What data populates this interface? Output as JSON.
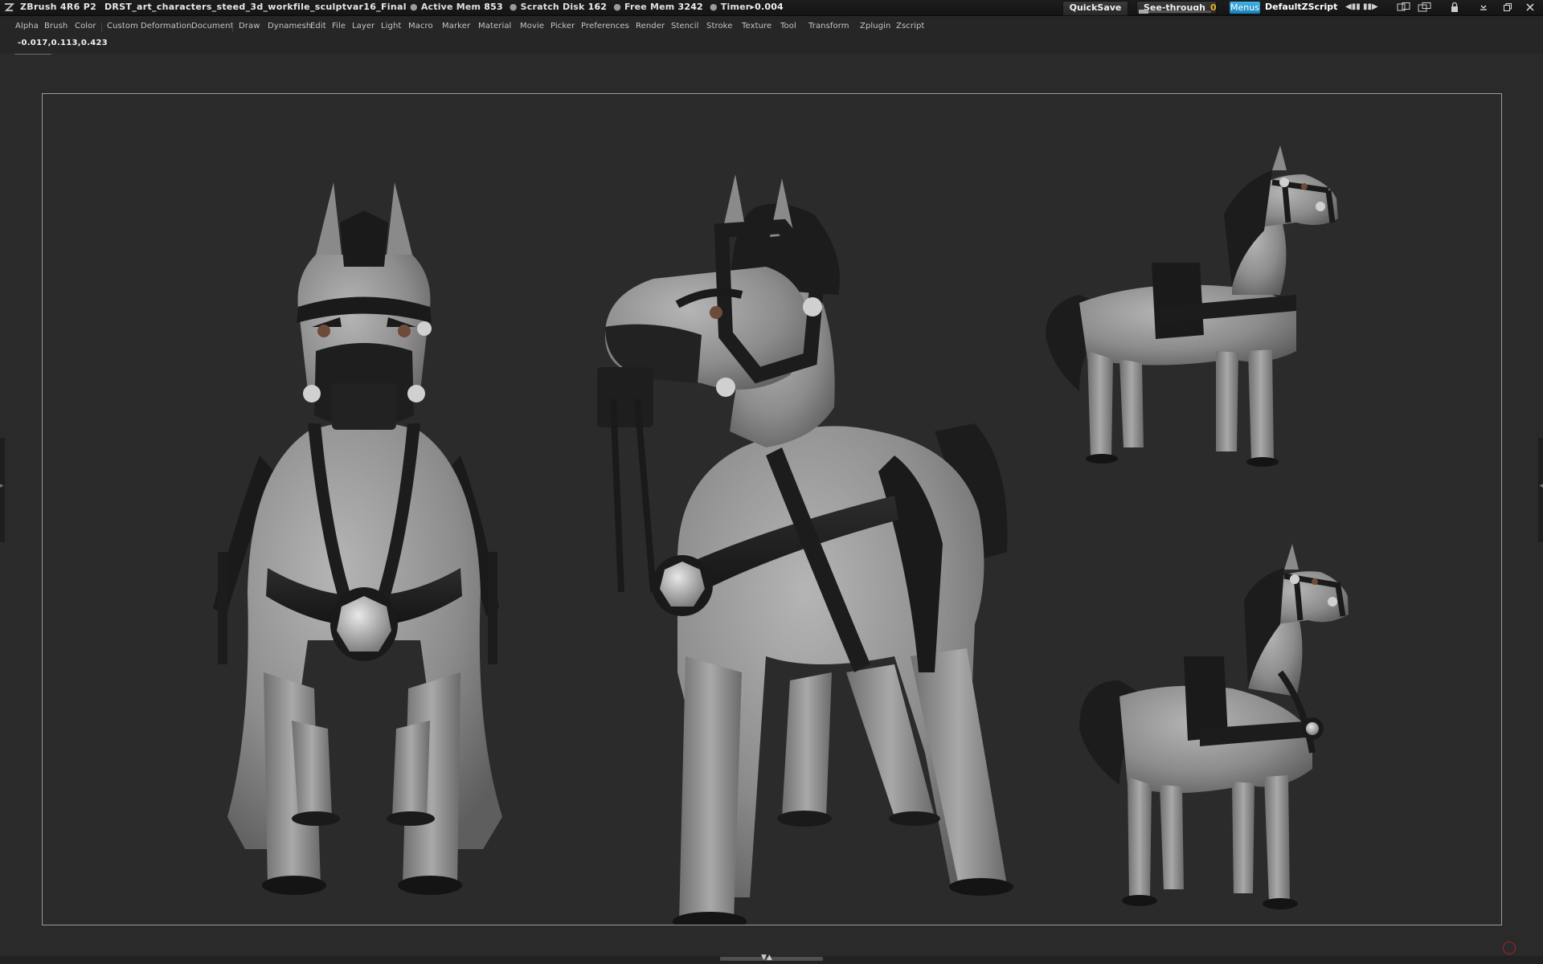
{
  "titlebar": {
    "app_name": "ZBrush 4R6 P2",
    "file_name": "DRST_art_characters_steed_3d_workfile_sculptvar16_Final",
    "stats": [
      {
        "label": "Active Mem",
        "value": "853"
      },
      {
        "label": "Scratch Disk",
        "value": "162"
      },
      {
        "label": "Free Mem",
        "value": "3242"
      },
      {
        "label": "Timer▸",
        "value": "0.004"
      }
    ],
    "quicksave": "QuickSave",
    "seethrough": "See-through",
    "seethrough_value": "0",
    "menus": "Menus",
    "default_script": "DefaultZScript"
  },
  "menubar": {
    "items": [
      "Alpha",
      "Brush",
      "Color",
      "Custom",
      "Deformation",
      "Document",
      "Draw",
      "Dynamesh",
      "Edit",
      "File",
      "Layer",
      "Light",
      "Macro",
      "Marker",
      "Material",
      "Movie",
      "Picker",
      "Preferences",
      "Render",
      "Stencil",
      "Stroke",
      "Texture",
      "Tool",
      "Transform",
      "Zplugin",
      "Zscript"
    ]
  },
  "coord_readout": "-0.017,0.113,0.423",
  "colors": {
    "background": "#2a2a2a",
    "accent": "#1a9ad6",
    "seethrough_value": "#e6b020"
  },
  "icons": [
    "zbrush-logo-icon",
    "arrows-left-icon",
    "arrows-right-icon",
    "layout-a-icon",
    "layout-b-icon",
    "lock-icon",
    "minimize-icon",
    "restore-icon",
    "close-icon",
    "tray-expand-icon"
  ]
}
